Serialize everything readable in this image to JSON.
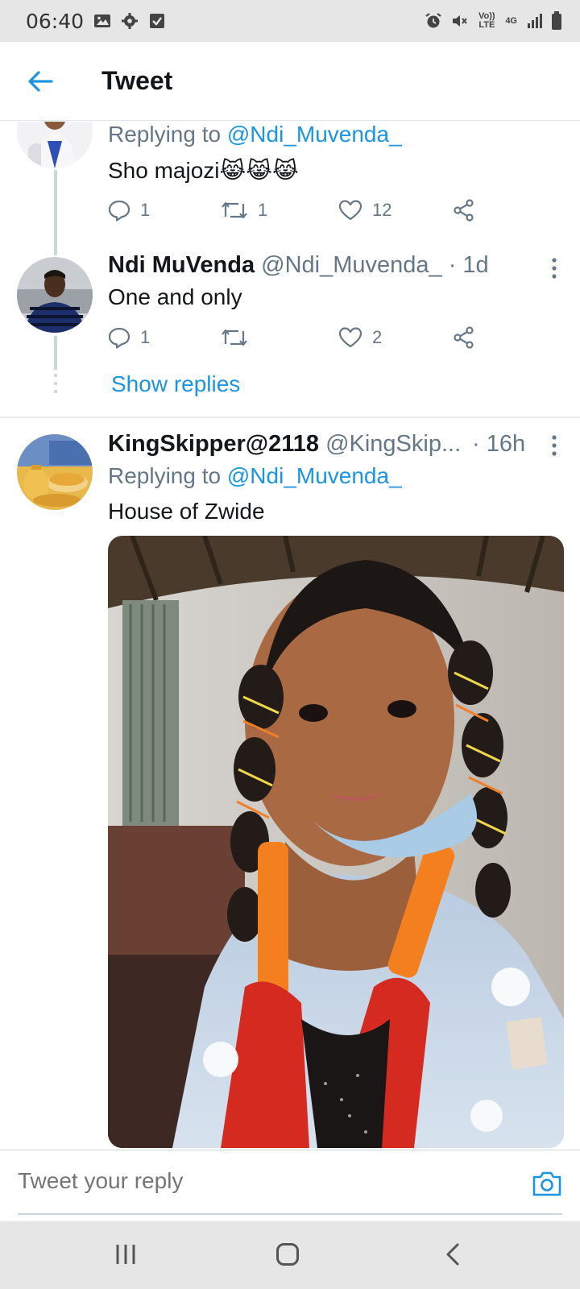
{
  "status_bar": {
    "time": "06:40",
    "network_label": "4G",
    "volte_label": "Vo)) LTE"
  },
  "header": {
    "title": "Tweet"
  },
  "tweet1": {
    "replying_label": "Replying to",
    "replying_handle": "@Ndi_Muvenda_",
    "text": "Sho majozi😹😹😹",
    "replies": "1",
    "retweets": "1",
    "likes": "12"
  },
  "tweet2": {
    "display_name": "Ndi MuVenda",
    "handle": "@Ndi_Muvenda_",
    "time": "· 1d",
    "text": "One and only",
    "replies": "1",
    "retweets": "",
    "likes": "2",
    "show_replies": "Show replies"
  },
  "tweet3": {
    "display_name": "KingSkipper@2118",
    "handle": "@KingSkip...",
    "time": "· 16h",
    "replying_label": "Replying to",
    "replying_handle": "@Ndi_Muvenda_",
    "text": "House of Zwide"
  },
  "reply_bar": {
    "placeholder": "Tweet your reply"
  },
  "colors": {
    "accent": "#1b95e0",
    "muted": "#657786",
    "text": "#14171a",
    "divider": "#e6ecf0"
  },
  "icons": [
    "back-arrow-icon",
    "reply-icon",
    "retweet-icon",
    "like-icon",
    "share-icon",
    "more-icon",
    "camera-icon",
    "recents-icon",
    "home-icon",
    "back-nav-icon"
  ]
}
